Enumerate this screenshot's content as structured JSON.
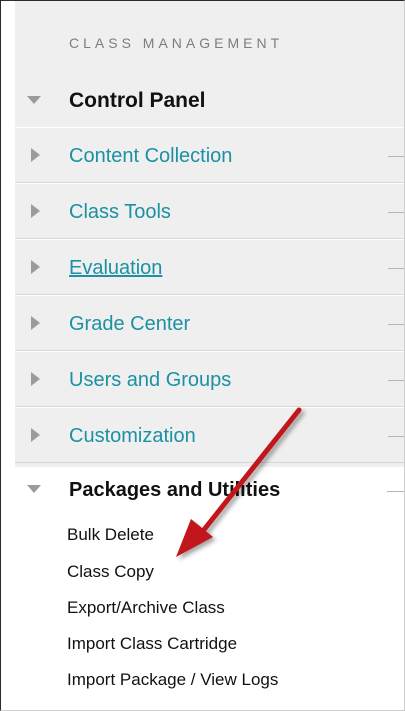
{
  "section_title": "CLASS MANAGEMENT",
  "control_panel": {
    "title": "Control Panel",
    "items": [
      {
        "label": "Content Collection"
      },
      {
        "label": "Class Tools"
      },
      {
        "label": "Evaluation"
      },
      {
        "label": "Grade Center"
      },
      {
        "label": "Users and Groups"
      },
      {
        "label": "Customization"
      }
    ]
  },
  "packages": {
    "title": "Packages and Utilities",
    "items": [
      {
        "label": "Bulk Delete"
      },
      {
        "label": "Class Copy"
      },
      {
        "label": "Export/Archive Class"
      },
      {
        "label": "Import Class Cartridge"
      },
      {
        "label": "Import Package / View Logs"
      }
    ]
  },
  "colors": {
    "link": "#1b91a3",
    "arrow": "#c0141c",
    "panel_bg": "#efefef"
  },
  "icons": {
    "collapse": "triangle-down-icon",
    "expand": "triangle-right-icon",
    "annotation": "red-arrow-icon"
  }
}
